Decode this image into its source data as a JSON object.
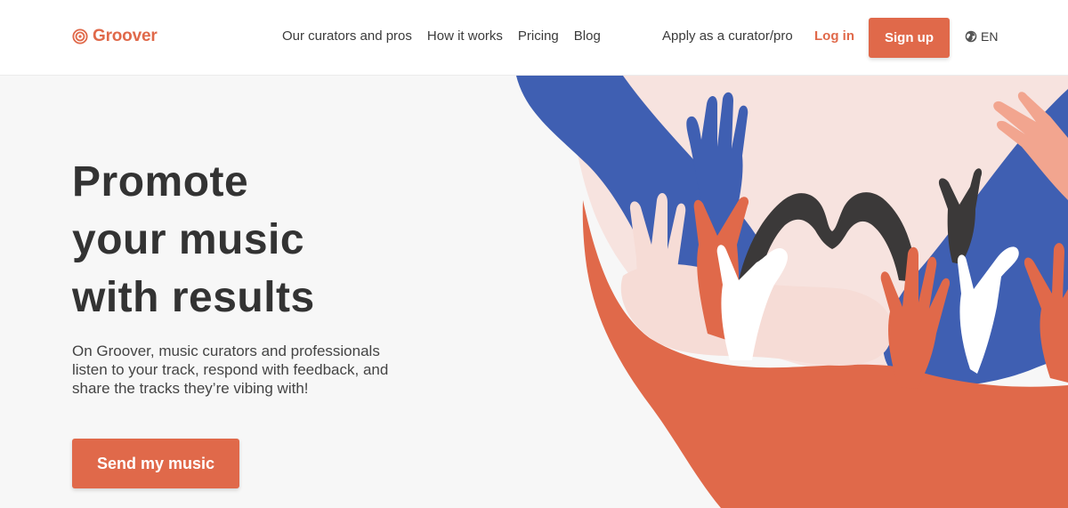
{
  "header": {
    "brand": "Groover",
    "nav": [
      {
        "label": "Our curators and pros"
      },
      {
        "label": "How it works"
      },
      {
        "label": "Pricing"
      },
      {
        "label": "Blog"
      }
    ],
    "apply_label": "Apply as a curator/pro",
    "login_label": "Log in",
    "signup_label": "Sign up",
    "language": "EN",
    "icons": {
      "logo": "groover-logo-icon",
      "language": "globe-icon"
    }
  },
  "hero": {
    "title_lines": [
      "Promote",
      "your music",
      "with results"
    ],
    "description": "On Groover, music curators and professionals listen to your track, respond with feedback, and share the tracks they’re vibing with!",
    "cta_label": "Send my music"
  },
  "colors": {
    "accent": "#e0694a",
    "blue": "#3f5fb2",
    "pink": "#f6e0dc",
    "dark": "#3b3939",
    "background": "#f7f7f7"
  }
}
